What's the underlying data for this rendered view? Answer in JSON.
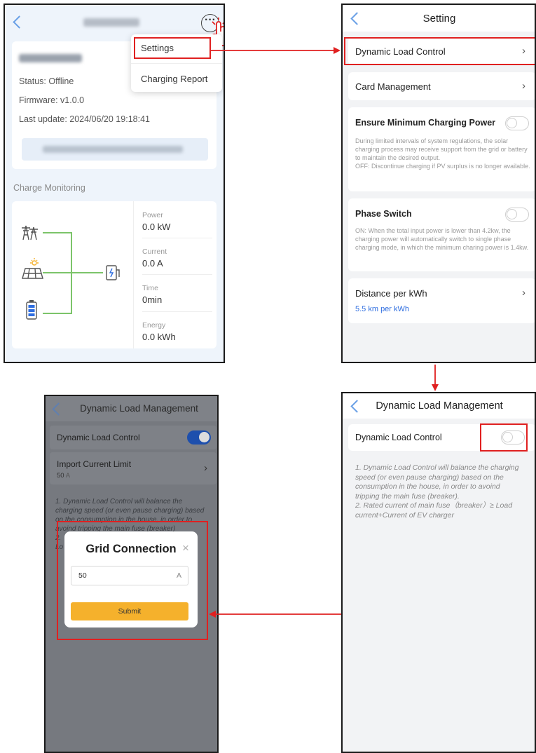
{
  "screen1": {
    "menu": {
      "settings": "Settings",
      "charging_report": "Charging Report"
    },
    "info": {
      "status": "Status: Offline",
      "firmware": "Firmware: v1.0.0",
      "last_update": "Last update: 2024/06/20 19:18:41"
    },
    "section_title": "Charge Monitoring",
    "metrics": {
      "power_label": "Power",
      "power_value": "0.0 kW",
      "current_label": "Current",
      "current_value": "0.0 A",
      "time_label": "Time",
      "time_value": "0min",
      "energy_label": "Energy",
      "energy_value": "0.0 kWh"
    }
  },
  "screen2": {
    "title": "Setting",
    "dynamic_load_control": "Dynamic Load Control",
    "card_management": "Card Management",
    "ensure_min_title": "Ensure Minimum Charging Power",
    "ensure_min_desc": "During limited intervals of system regulations, the solar charging process may receive support from the grid or battery to maintain the desired output.\nOFF:  Discontinue charging if PV surplus is no longer available.",
    "phase_switch_title": "Phase Switch",
    "phase_switch_desc": "ON:  When the total input power is lower than 4.2kw, the charging power will automatically switch to single phase charging mode, in which the minimum charing power is 1.4kw.",
    "distance_title": "Distance per kWh",
    "distance_value": "5.5 km per kWh"
  },
  "screen3": {
    "title": "Dynamic Load Management",
    "dynamic_load_control": "Dynamic Load Control",
    "dynamic_load_control_on": false,
    "note": "1. Dynamic Load Control will balance the charging speed (or even pause charging) based on the consumption in the house, in order to avoind tripping the main fuse (breaker).\n2. Rated current of main fuse（breaker）≥ Load current+Current of EV charger"
  },
  "screen4": {
    "title": "Dynamic Load Management",
    "dynamic_load_control": "Dynamic Load Control",
    "dynamic_load_control_on": true,
    "import_limit_title": "Import Current Limit",
    "import_limit_value": "50",
    "import_limit_unit": "A",
    "bg_note_line1": "1. Dynamic Load Control will balance the",
    "bg_note_line2": "charging speed (or even pause charging) based",
    "bg_note_line3": "on the consumption in the house, in order to",
    "bg_note_line4": "avoind tripping the main fuse (breaker)",
    "bg_note_line5": "2.",
    "bg_note_line6": "Lo",
    "dialog": {
      "title": "Grid Connection",
      "input_value": "50",
      "unit": "A",
      "submit_label": "Submit"
    }
  },
  "colors": {
    "accent_blue": "#2f6ee0",
    "highlight_red": "#e02020",
    "submit_yellow": "#f5b12c",
    "line_green": "#7cc46a"
  },
  "icons": [
    "back-arrow-icon",
    "more-icon",
    "hand-cursor-icon",
    "transmission-tower-icon",
    "solar-panel-icon",
    "battery-icon",
    "ev-charger-icon",
    "chevron-right-icon",
    "close-icon",
    "arrow-icon"
  ]
}
